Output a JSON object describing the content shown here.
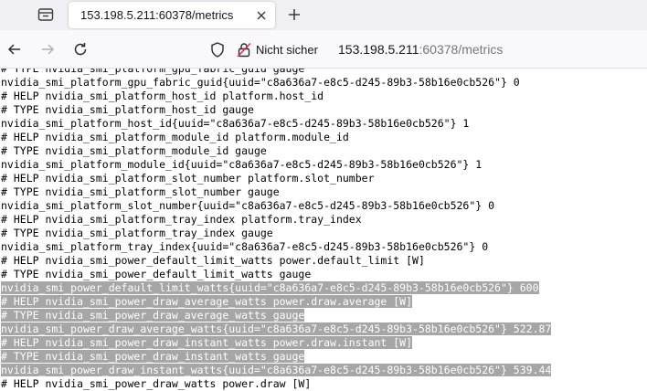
{
  "browser": {
    "tab_title": "153.198.5.211:60378/metrics",
    "security_label": "Nicht sicher",
    "url_host": "153.198.5.211",
    "url_path": ":60378/metrics"
  },
  "content": {
    "lines": [
      {
        "text": "# TYPE nvidia_smi_platform_gpu_fabric_guid gauge",
        "selected": false
      },
      {
        "text": "nvidia_smi_platform_gpu_fabric_guid{uuid=\"c8a636a7-e8c5-d245-89b3-58b16e0cb526\"} 0",
        "selected": false
      },
      {
        "text": "# HELP nvidia_smi_platform_host_id platform.host_id",
        "selected": false
      },
      {
        "text": "# TYPE nvidia_smi_platform_host_id gauge",
        "selected": false
      },
      {
        "text": "nvidia_smi_platform_host_id{uuid=\"c8a636a7-e8c5-d245-89b3-58b16e0cb526\"} 1",
        "selected": false
      },
      {
        "text": "# HELP nvidia_smi_platform_module_id platform.module_id",
        "selected": false
      },
      {
        "text": "# TYPE nvidia_smi_platform_module_id gauge",
        "selected": false
      },
      {
        "text": "nvidia_smi_platform_module_id{uuid=\"c8a636a7-e8c5-d245-89b3-58b16e0cb526\"} 1",
        "selected": false
      },
      {
        "text": "# HELP nvidia_smi_platform_slot_number platform.slot_number",
        "selected": false
      },
      {
        "text": "# TYPE nvidia_smi_platform_slot_number gauge",
        "selected": false
      },
      {
        "text": "nvidia_smi_platform_slot_number{uuid=\"c8a636a7-e8c5-d245-89b3-58b16e0cb526\"} 0",
        "selected": false
      },
      {
        "text": "# HELP nvidia_smi_platform_tray_index platform.tray_index",
        "selected": false
      },
      {
        "text": "# TYPE nvidia_smi_platform_tray_index gauge",
        "selected": false
      },
      {
        "text": "nvidia_smi_platform_tray_index{uuid=\"c8a636a7-e8c5-d245-89b3-58b16e0cb526\"} 0",
        "selected": false
      },
      {
        "text": "# HELP nvidia_smi_power_default_limit_watts power.default_limit [W]",
        "selected": false
      },
      {
        "text": "# TYPE nvidia_smi_power_default_limit_watts gauge",
        "selected": false
      },
      {
        "text": "nvidia_smi_power_default_limit_watts{uuid=\"c8a636a7-e8c5-d245-89b3-58b16e0cb526\"} 600",
        "selected": true
      },
      {
        "text": "# HELP nvidia_smi_power_draw_average_watts power.draw.average [W]",
        "selected": true
      },
      {
        "text": "# TYPE nvidia_smi_power_draw_average_watts gauge",
        "selected": true
      },
      {
        "text": "nvidia_smi_power_draw_average_watts{uuid=\"c8a636a7-e8c5-d245-89b3-58b16e0cb526\"} 522.87",
        "selected": true
      },
      {
        "text": "# HELP nvidia_smi_power_draw_instant_watts power.draw.instant [W]",
        "selected": true
      },
      {
        "text": "# TYPE nvidia_smi_power_draw_instant_watts gauge",
        "selected": true
      },
      {
        "text": "nvidia_smi_power_draw_instant_watts{uuid=\"c8a636a7-e8c5-d245-89b3-58b16e0cb526\"} 539.44",
        "selected": true
      },
      {
        "text": "# HELP nvidia_smi_power_draw_watts power.draw [W]",
        "selected": false
      }
    ]
  },
  "icons": {
    "tab_list": "tab-list-icon",
    "close": "close-icon",
    "new_tab": "plus-icon",
    "back": "arrow-left-icon",
    "forward": "arrow-right-icon",
    "reload": "reload-icon",
    "shield": "shield-icon",
    "insecure_lock": "broken-lock-icon"
  },
  "colors": {
    "selection_bg": "#a6a6a6",
    "tabstrip_bg": "#f0f0f4",
    "navbar_bg": "#f9f9fb"
  }
}
